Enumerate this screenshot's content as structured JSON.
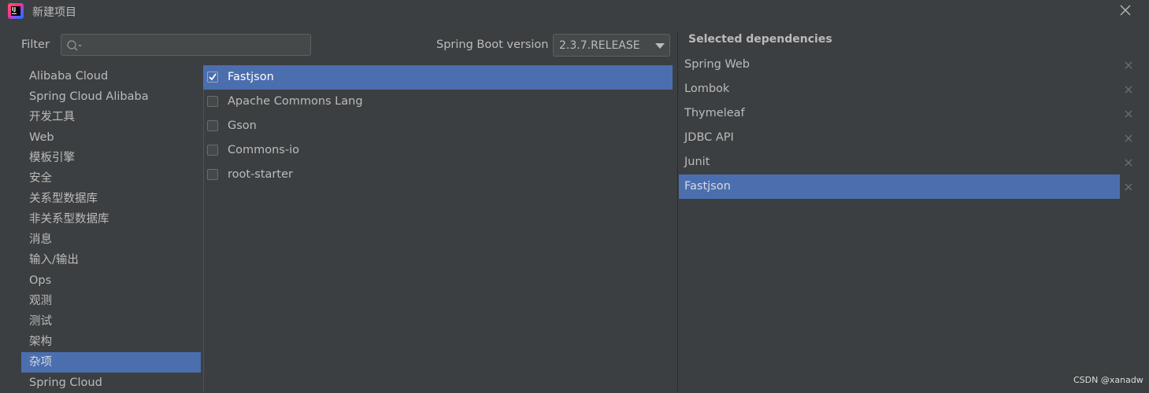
{
  "window": {
    "title": "新建项目",
    "logo_text": "IJ"
  },
  "filter": {
    "label": "Filter",
    "value": "",
    "placeholder": ""
  },
  "version": {
    "label": "Spring Boot version",
    "value": "2.3.7.RELEASE"
  },
  "categories": [
    {
      "label": "Alibaba Cloud",
      "selected": false
    },
    {
      "label": "Spring Cloud Alibaba",
      "selected": false
    },
    {
      "label": "开发工具",
      "selected": false
    },
    {
      "label": "Web",
      "selected": false
    },
    {
      "label": "模板引擎",
      "selected": false
    },
    {
      "label": "安全",
      "selected": false
    },
    {
      "label": "关系型数据库",
      "selected": false
    },
    {
      "label": "非关系型数据库",
      "selected": false
    },
    {
      "label": "消息",
      "selected": false
    },
    {
      "label": "输入/输出",
      "selected": false
    },
    {
      "label": "Ops",
      "selected": false
    },
    {
      "label": "观测",
      "selected": false
    },
    {
      "label": "测试",
      "selected": false
    },
    {
      "label": "架构",
      "selected": false
    },
    {
      "label": "杂项",
      "selected": true
    },
    {
      "label": "Spring Cloud",
      "selected": false
    }
  ],
  "dependencies": [
    {
      "label": "Fastjson",
      "checked": true,
      "selected": true
    },
    {
      "label": "Apache Commons Lang",
      "checked": false,
      "selected": false
    },
    {
      "label": "Gson",
      "checked": false,
      "selected": false
    },
    {
      "label": "Commons-io",
      "checked": false,
      "selected": false
    },
    {
      "label": "root-starter",
      "checked": false,
      "selected": false
    }
  ],
  "selected_dependencies": {
    "title": "Selected dependencies",
    "items": [
      {
        "label": "Spring Web",
        "selected": false
      },
      {
        "label": "Lombok",
        "selected": false
      },
      {
        "label": "Thymeleaf",
        "selected": false
      },
      {
        "label": "JDBC API",
        "selected": false
      },
      {
        "label": "Junit",
        "selected": false
      },
      {
        "label": "Fastjson",
        "selected": true
      }
    ]
  },
  "watermark": "CSDN @xanadw",
  "colors": {
    "background": "#3c3f41",
    "selection": "#4b6eaf",
    "text": "#bbbbbb"
  }
}
